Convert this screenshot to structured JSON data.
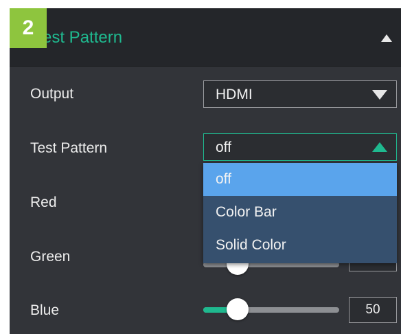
{
  "annotation_badge": "2",
  "section": {
    "title": "Test Pattern"
  },
  "output": {
    "label": "Output",
    "value": "HDMI"
  },
  "test_pattern": {
    "label": "Test Pattern",
    "value": "off",
    "options": [
      "off",
      "Color Bar",
      "Solid Color"
    ]
  },
  "red": {
    "label": "Red",
    "value": ""
  },
  "green": {
    "label": "Green",
    "value": ""
  },
  "blue": {
    "label": "Blue",
    "value": "50",
    "fraction": 0.25
  },
  "colors": {
    "accent": "#1fb98f",
    "selected_option": "#5aa4ec",
    "badge": "#8ec53e"
  },
  "icons": {
    "collapse": "triangle-up-icon",
    "dropdown_closed": "triangle-down-icon",
    "dropdown_open": "triangle-up-icon"
  }
}
